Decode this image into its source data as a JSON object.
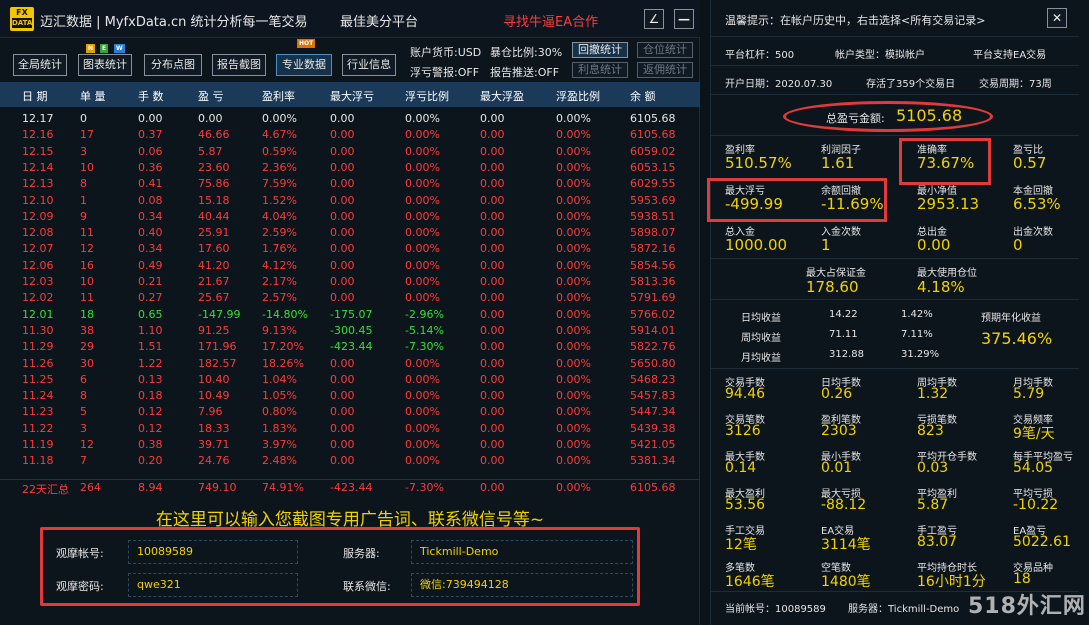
{
  "window": {
    "logo_top": "FX",
    "logo_bottom": "DATA",
    "title": "迈汇数据 | MyfxData.cn  统计分析每一笔交易",
    "slogan": "最佳美分平台",
    "ea_link": "寻找牛逼EA合作",
    "min_label": "∠",
    "close_label": "—"
  },
  "toolbar": {
    "buttons": [
      {
        "label": "全局统计"
      },
      {
        "label": "图表统计"
      },
      {
        "label": "分布点图"
      },
      {
        "label": "报告截图"
      },
      {
        "label": "专业数据"
      },
      {
        "label": "行业信息"
      }
    ],
    "badges": {
      "n": "N",
      "e": "E",
      "w": "W",
      "hot": "HOT"
    },
    "options": {
      "currency": "账户货币:USD",
      "exposure": "暴仓比例:30%",
      "float_warning": "浮亏警报:OFF",
      "report_push": "报告推送:OFF"
    },
    "small_buttons": {
      "withdraw_stats": "回撤统计",
      "position_stats": "仓位统计",
      "interest_stats": "利息统计",
      "rebate_stats": "返佣统计"
    }
  },
  "table": {
    "headers": [
      "日 期",
      "单 量",
      "手 数",
      "盈 亏",
      "盈利率",
      "最大浮亏",
      "浮亏比例",
      "最大浮盈",
      "浮盈比例",
      "余 额"
    ],
    "rows": [
      {
        "c": [
          "12.17",
          "0",
          "0.00",
          "0.00",
          "0.00%",
          "0.00",
          "0.00%",
          "0.00",
          "0.00%",
          "6105.68"
        ],
        "color": "#e6e6e6"
      },
      {
        "c": [
          "12.16",
          "17",
          "0.37",
          "46.66",
          "4.67%",
          "0.00",
          "0.00%",
          "0.00",
          "0.00%",
          "6105.68"
        ],
        "color": "#ff3b3b"
      },
      {
        "c": [
          "12.15",
          "3",
          "0.06",
          "5.87",
          "0.59%",
          "0.00",
          "0.00%",
          "0.00",
          "0.00%",
          "6059.02"
        ],
        "color": "#ff3b3b"
      },
      {
        "c": [
          "12.14",
          "10",
          "0.36",
          "23.60",
          "2.36%",
          "0.00",
          "0.00%",
          "0.00",
          "0.00%",
          "6053.15"
        ],
        "color": "#ff3b3b"
      },
      {
        "c": [
          "12.13",
          "8",
          "0.41",
          "75.86",
          "7.59%",
          "0.00",
          "0.00%",
          "0.00",
          "0.00%",
          "6029.55"
        ],
        "color": "#ff3b3b"
      },
      {
        "c": [
          "12.10",
          "1",
          "0.08",
          "15.18",
          "1.52%",
          "0.00",
          "0.00%",
          "0.00",
          "0.00%",
          "5953.69"
        ],
        "color": "#ff3b3b"
      },
      {
        "c": [
          "12.09",
          "9",
          "0.34",
          "40.44",
          "4.04%",
          "0.00",
          "0.00%",
          "0.00",
          "0.00%",
          "5938.51"
        ],
        "color": "#ff3b3b"
      },
      {
        "c": [
          "12.08",
          "11",
          "0.40",
          "25.91",
          "2.59%",
          "0.00",
          "0.00%",
          "0.00",
          "0.00%",
          "5898.07"
        ],
        "color": "#ff3b3b"
      },
      {
        "c": [
          "12.07",
          "12",
          "0.34",
          "17.60",
          "1.76%",
          "0.00",
          "0.00%",
          "0.00",
          "0.00%",
          "5872.16"
        ],
        "color": "#ff3b3b"
      },
      {
        "c": [
          "12.06",
          "16",
          "0.49",
          "41.20",
          "4.12%",
          "0.00",
          "0.00%",
          "0.00",
          "0.00%",
          "5854.56"
        ],
        "color": "#ff3b3b"
      },
      {
        "c": [
          "12.03",
          "10",
          "0.21",
          "21.67",
          "2.17%",
          "0.00",
          "0.00%",
          "0.00",
          "0.00%",
          "5813.36"
        ],
        "color": "#ff3b3b"
      },
      {
        "c": [
          "12.02",
          "11",
          "0.27",
          "25.67",
          "2.57%",
          "0.00",
          "0.00%",
          "0.00",
          "0.00%",
          "5791.69"
        ],
        "color": "#ff3b3b"
      },
      {
        "c": [
          "12.01",
          "18",
          "0.65",
          "-147.99",
          "-14.80%",
          "-175.07",
          "-2.96%",
          "0.00",
          "0.00%",
          "5766.02"
        ],
        "color": "#34e034"
      },
      {
        "c": [
          "11.30",
          "38",
          "1.10",
          "91.25",
          "9.13%",
          "-300.45",
          "-5.14%",
          "0.00",
          "0.00%",
          "5914.01"
        ],
        "color": "#ff3b3b"
      },
      {
        "c": [
          "11.29",
          "29",
          "1.51",
          "171.96",
          "17.20%",
          "-423.44",
          "-7.30%",
          "0.00",
          "0.00%",
          "5822.76"
        ],
        "color": "#ff3b3b"
      },
      {
        "c": [
          "11.26",
          "30",
          "1.22",
          "182.57",
          "18.26%",
          "0.00",
          "0.00%",
          "0.00",
          "0.00%",
          "5650.80"
        ],
        "color": "#ff3b3b"
      },
      {
        "c": [
          "11.25",
          "6",
          "0.13",
          "10.40",
          "1.04%",
          "0.00",
          "0.00%",
          "0.00",
          "0.00%",
          "5468.23"
        ],
        "color": "#ff3b3b"
      },
      {
        "c": [
          "11.24",
          "8",
          "0.18",
          "10.49",
          "1.05%",
          "0.00",
          "0.00%",
          "0.00",
          "0.00%",
          "5457.83"
        ],
        "color": "#ff3b3b"
      },
      {
        "c": [
          "11.23",
          "5",
          "0.12",
          "7.96",
          "0.80%",
          "0.00",
          "0.00%",
          "0.00",
          "0.00%",
          "5447.34"
        ],
        "color": "#ff3b3b"
      },
      {
        "c": [
          "11.22",
          "3",
          "0.12",
          "18.33",
          "1.83%",
          "0.00",
          "0.00%",
          "0.00",
          "0.00%",
          "5439.38"
        ],
        "color": "#ff3b3b"
      },
      {
        "c": [
          "11.19",
          "12",
          "0.38",
          "39.71",
          "3.97%",
          "0.00",
          "0.00%",
          "0.00",
          "0.00%",
          "5421.05"
        ],
        "color": "#ff3b3b"
      },
      {
        "c": [
          "11.18",
          "7",
          "0.20",
          "24.76",
          "2.48%",
          "0.00",
          "0.00%",
          "0.00",
          "0.00%",
          "5381.34"
        ],
        "color": "#ff3b3b"
      }
    ],
    "mixed_colors": {
      "row12_green_cols": [
        0,
        1,
        2,
        3,
        4,
        5,
        6
      ],
      "row13_green_cols": [
        5,
        6
      ],
      "row14_green_cols": [
        5,
        6
      ]
    },
    "summary": [
      "22天汇总",
      "264",
      "8.94",
      "749.10",
      "74.91%",
      "-423.44",
      "-7.30%",
      "0.00",
      "0.00%",
      "6105.68"
    ]
  },
  "ad_text": "在这里可以输入您截图专用广告词、联系微信号等~",
  "login": {
    "account_label": "观摩帐号:",
    "account_value": "10089589",
    "password_label": "观摩密码:",
    "password_value": "qwe321",
    "server_label": "服务器:",
    "server_value": "Tickmill-Demo",
    "wechat_label": "联系微信:",
    "wechat_value": "微信:739494128"
  },
  "right": {
    "tip": "温馨提示：在帐户历史中，右击选择<所有交易记录>",
    "close_label": "✕",
    "leverage": "平台杠杆：500",
    "account_type": "帐户类型：模拟帐户",
    "ea_support": "平台支持EA交易",
    "open_date": "开户日期：2020.07.30",
    "survival": "存活了359个交易日",
    "trade_cycle": "交易周期：73周",
    "total_pnl_label": "总盈亏金额:",
    "total_pnl_value": "5105.68",
    "grid1": [
      {
        "label": "盈利率",
        "value": "510.57%"
      },
      {
        "label": "利润因子",
        "value": "1.61"
      },
      {
        "label": "准确率",
        "value": "73.67%"
      },
      {
        "label": "盈亏比",
        "value": "0.57"
      },
      {
        "label": "最大浮亏",
        "value": "-499.99"
      },
      {
        "label": "余额回撤",
        "value": "-11.69%"
      },
      {
        "label": "最小净值",
        "value": "2953.13"
      },
      {
        "label": "本金回撤",
        "value": "6.53%"
      },
      {
        "label": "总入金",
        "value": "1000.00"
      },
      {
        "label": "入金次数",
        "value": "1"
      },
      {
        "label": "总出金",
        "value": "0.00"
      },
      {
        "label": "出金次数",
        "value": "0"
      }
    ],
    "max_margin_label": "最大占保证金",
    "max_margin_value": "178.60",
    "max_position_label": "最大使用仓位",
    "max_position_value": "4.18%",
    "avg": {
      "daily_label": "日均收益",
      "daily_value": "14.22",
      "daily_pct": "1.42%",
      "weekly_label": "周均收益",
      "weekly_value": "71.11",
      "weekly_pct": "7.11%",
      "monthly_label": "月均收益",
      "monthly_value": "312.88",
      "monthly_pct": "31.29%",
      "annual_label": "预期年化收益",
      "annual_value": "375.46%"
    },
    "grid2": [
      {
        "label": "交易手数",
        "value": "94.46"
      },
      {
        "label": "日均手数",
        "value": "0.26"
      },
      {
        "label": "周均手数",
        "value": "1.32"
      },
      {
        "label": "月均手数",
        "value": "5.79"
      },
      {
        "label": "交易笔数",
        "value": "3126"
      },
      {
        "label": "盈利笔数",
        "value": "2303"
      },
      {
        "label": "亏损笔数",
        "value": "823"
      },
      {
        "label": "交易频率",
        "value": "9笔/天"
      },
      {
        "label": "最大手数",
        "value": "0.14"
      },
      {
        "label": "最小手数",
        "value": "0.01"
      },
      {
        "label": "平均开仓手数",
        "value": "0.03"
      },
      {
        "label": "每手平均盈亏",
        "value": "54.05"
      },
      {
        "label": "最大盈利",
        "value": "53.56"
      },
      {
        "label": "最大亏损",
        "value": "-88.12"
      },
      {
        "label": "平均盈利",
        "value": "5.87"
      },
      {
        "label": "平均亏损",
        "value": "-10.22"
      },
      {
        "label": "手工交易",
        "value": "12笔"
      },
      {
        "label": "EA交易",
        "value": "3114笔"
      },
      {
        "label": "手工盈亏",
        "value": "83.07"
      },
      {
        "label": "EA盈亏",
        "value": "5022.61"
      },
      {
        "label": "多笔数",
        "value": "1646笔"
      },
      {
        "label": "空笔数",
        "value": "1480笔"
      },
      {
        "label": "平均持仓时长",
        "value": "16小时1分"
      },
      {
        "label": "交易品种",
        "value": "18"
      }
    ],
    "footer_account": "当前帐号：10089589",
    "footer_server": "服务器：Tickmill-Demo"
  },
  "watermark": "518外汇网",
  "colors": {
    "accent_red": "#e03a3a",
    "value_yellow": "#f2d200",
    "header_blue": "#1b3a5a",
    "profit_green": "#34e034",
    "loss_red": "#ff3b3b"
  }
}
